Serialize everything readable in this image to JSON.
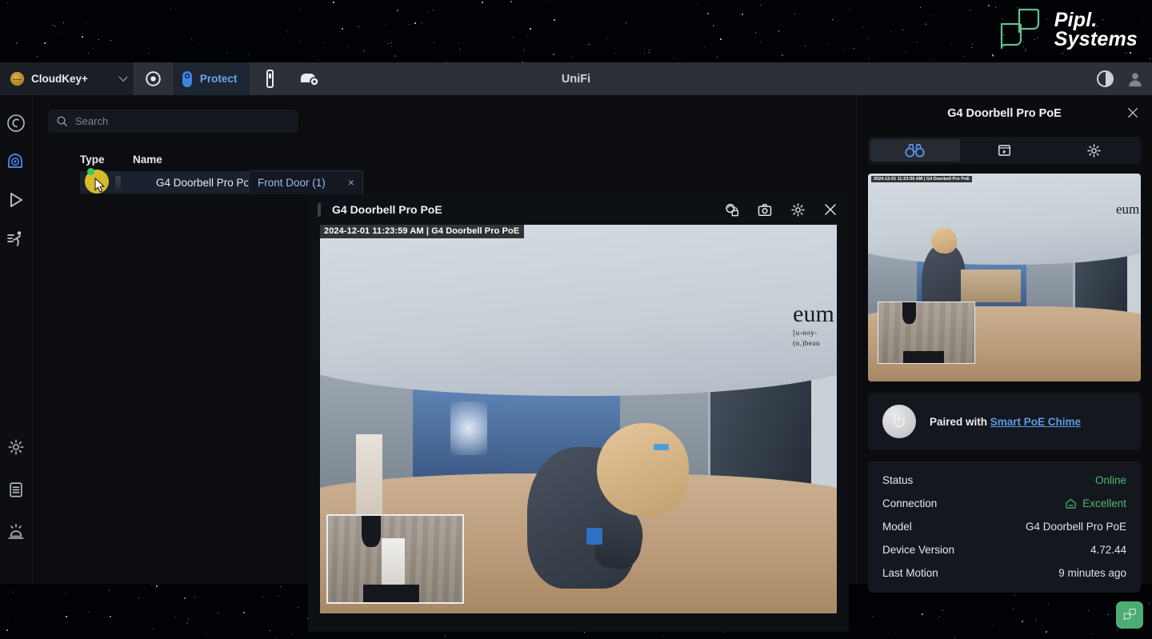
{
  "brand": {
    "name_line1": "Pipl.",
    "name_line2": "Systems",
    "accent": "#66c08a"
  },
  "titlebar": {
    "console_label": "CloudKey+",
    "app_title": "UniFi",
    "protect_label": "Protect",
    "icons": {
      "dropdown": "chevron-down-icon",
      "network": "network-icon",
      "protect": "protect-camera-icon",
      "device": "device-icon",
      "access": "access-door-icon",
      "contrast": "contrast-toggle-icon",
      "user": "user-avatar-icon"
    }
  },
  "rail": {
    "items": [
      {
        "name": "dashboard",
        "icon": "dashboard-icon",
        "active": false
      },
      {
        "name": "cameras",
        "icon": "camera-icon",
        "active": true
      },
      {
        "name": "playback",
        "icon": "play-icon",
        "active": false
      },
      {
        "name": "detections",
        "icon": "motion-person-icon",
        "active": false
      }
    ],
    "bottom_items": [
      {
        "name": "settings",
        "icon": "gear-icon"
      },
      {
        "name": "logs",
        "icon": "clipboard-icon"
      },
      {
        "name": "alarms",
        "icon": "siren-icon"
      }
    ]
  },
  "search": {
    "placeholder": "Search",
    "value": "",
    "icon": "search-icon"
  },
  "filter_chip": {
    "label": "Front Door (1)",
    "close": "×"
  },
  "device_table": {
    "columns": [
      "Type",
      "Name"
    ],
    "rows": [
      {
        "type_icon": "doorbell-chip-icon",
        "name": "G4 Doorbell Pro PoE",
        "status": "online",
        "selected": true
      }
    ]
  },
  "player": {
    "title": "G4 Doorbell Pro PoE",
    "overlay_timestamp": "2024-12-01  11:23:59 AM  |  G4 Doorbell Pro PoE",
    "tools": [
      {
        "name": "privacy-zone-icon",
        "label": "Privacy Zones"
      },
      {
        "name": "camera-snapshot-icon",
        "label": "Snapshot"
      },
      {
        "name": "gear-icon",
        "label": "Settings"
      },
      {
        "name": "close-icon",
        "label": "Close"
      }
    ],
    "scene_wall_word": "eum",
    "scene_wall_sub1": "[u-noy-",
    "scene_wall_sub2": "(n.)beau"
  },
  "drawer": {
    "title": "G4 Doorbell Pro PoE",
    "close_icon": "close-icon",
    "tabs": [
      {
        "name": "live-view",
        "icon": "binoculars-icon",
        "active": true
      },
      {
        "name": "recordings",
        "icon": "film-play-icon",
        "active": false
      },
      {
        "name": "settings",
        "icon": "gear-icon",
        "active": false
      }
    ],
    "thumbnail_timestamp": "2024-12-01  11:23:56 AM  |  G4 Doorbell Pro PoE",
    "paired": {
      "prefix": "Paired with",
      "device": "Smart PoE Chime",
      "avatar_icon": "power-circle-icon"
    },
    "info": [
      {
        "key": "Status",
        "value": "Online",
        "color": "#4eb871",
        "icon": null
      },
      {
        "key": "Connection",
        "value": "Excellent",
        "color": "#4eb871",
        "icon": "signal-home-icon"
      },
      {
        "key": "Model",
        "value": "G4 Doorbell Pro PoE",
        "color": "#dfe3e9",
        "icon": null
      },
      {
        "key": "Device Version",
        "value": "4.72.44",
        "color": "#dfe3e9",
        "icon": null
      },
      {
        "key": "Last Motion",
        "value": "9 minutes ago",
        "color": "#dfe3e9",
        "icon": null
      }
    ]
  },
  "fab": {
    "icon": "pipl-logo-icon",
    "color": "#4eab74"
  }
}
